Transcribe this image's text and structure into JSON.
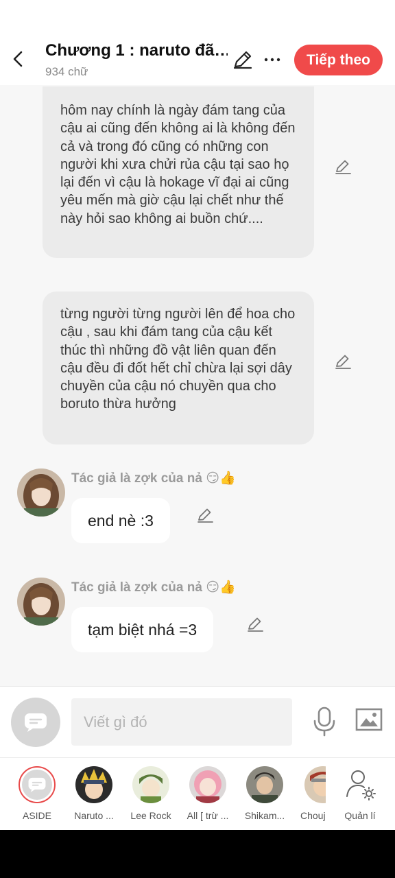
{
  "header": {
    "title": "Chương 1 : naruto đã…",
    "subtitle": "934 chữ",
    "next_label": "Tiếp theo",
    "accent": "#f04a4a"
  },
  "narrations": [
    {
      "text": "hôm nay chính là ngày đám tang của cậu ai cũng đến không ai là không đến cả và trong đó cũng có những con người khi xưa chửi rủa cậu tại sao họ lại đến vì cậu là hokage vĩ đại ai cũng yêu mến mà giờ cậu lại chết như thế này hỏi sao không ai buồn chứ...."
    },
    {
      "text": "từng người từng người lên để hoa cho cậu , sau khi đám tang của cậu kết thúc thì những đồ vật liên quan đến cậu đều đi đốt hết chỉ chừa lại sợi dây chuyền của cậu nó chuyền qua cho boruto thừa hưởng"
    }
  ],
  "messages": [
    {
      "sender": "Tác giả là zợk của nả 😏👍",
      "text": "end nè :3"
    },
    {
      "sender": "Tác giả là zợk của nả 😏👍",
      "text": "tạm biệt nhá =3"
    }
  ],
  "composer": {
    "placeholder": "Viết gì đó"
  },
  "characters": [
    {
      "name": "ASIDE",
      "selected": true
    },
    {
      "name": "Naruto ..."
    },
    {
      "name": "Lee Rock"
    },
    {
      "name": "All [ trừ ..."
    },
    {
      "name": "Shikam..."
    },
    {
      "name": "Chouj"
    },
    {
      "name": "Quản lí"
    }
  ],
  "icons": {
    "back": "chevron-left-icon",
    "edit": "pencil-icon",
    "more": "ellipsis-icon",
    "mic": "microphone-icon",
    "image": "image-icon",
    "manage": "user-settings-icon"
  }
}
